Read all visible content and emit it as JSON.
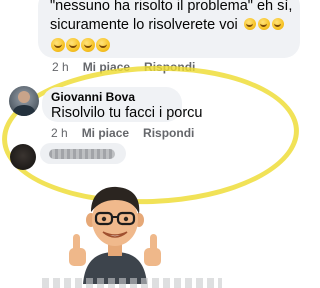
{
  "top_comment": {
    "line1": "\"nessuno ha risolto il problema\" eh sì,",
    "line2": "sicuramente lo risolverete voi",
    "actions": {
      "time": "2 h",
      "like": "Mi piace",
      "reply": "Rispondi"
    }
  },
  "reply_comment": {
    "author": "Giovanni Bova",
    "text": "Risolvilo tu facci i porcu",
    "actions": {
      "time": "2 h",
      "like": "Mi piace",
      "reply": "Rispondi"
    }
  },
  "colors": {
    "bubble": "#f0f2f5",
    "meta_text": "#65676b",
    "highlight": "#eedc32"
  },
  "icons": [
    "laughing-emoji-icon",
    "user-avatar",
    "memoji-thumbs-up-sticker"
  ]
}
